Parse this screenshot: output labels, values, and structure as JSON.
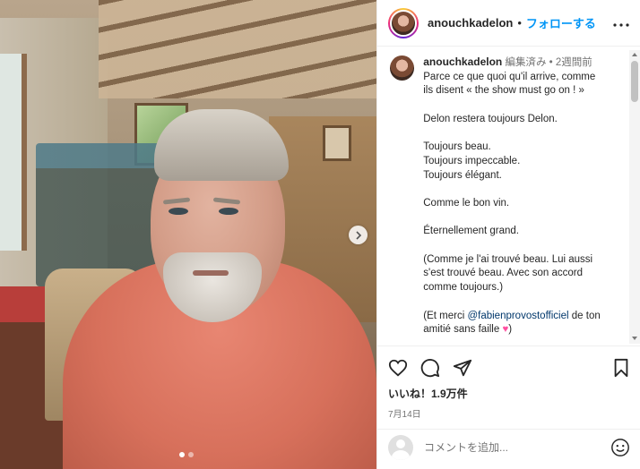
{
  "header": {
    "username": "anouchkadelon",
    "separator": "•",
    "follow_label": "フォローする",
    "more_label": "•••"
  },
  "caption": {
    "username": "anouchkadelon",
    "edited_label": "編集済み",
    "separator": "•",
    "time_ago": "2週間前",
    "lines": [
      "Parce ce que quoi qu'il arrive, comme",
      "ils disent « the show must go on ! »",
      "",
      "Delon restera toujours Delon.",
      "",
      "Toujours beau.",
      "Toujours impeccable.",
      "Toujours élégant.",
      "",
      "Comme le bon vin.",
      "",
      "Éternellement grand.",
      "",
      "(Comme je l'ai trouvé beau. Lui aussi",
      "s'est trouvé beau. Avec son accord",
      "comme toujours.)",
      ""
    ],
    "last_line_prefix": "(Et merci ",
    "mention": "@fabienprovostofficiel",
    "last_line_suffix": " de ton",
    "final_line": "amitié sans faille ",
    "final_emoji": "♥",
    "final_close": ")"
  },
  "actions": {
    "like_icon": "heart-icon",
    "comment_icon": "comment-icon",
    "share_icon": "share-icon",
    "save_icon": "bookmark-icon"
  },
  "likes_label": "いいね！1.9万件",
  "date_label": "7月14日",
  "comment": {
    "placeholder": "コメントを追加...",
    "emoji_icon": "smile-icon"
  },
  "carousel": {
    "next_icon": "chevron-right-icon",
    "slide_count": 2,
    "active_index": 0
  },
  "colors": {
    "accent": "#0095f6",
    "mention": "#00376b",
    "meta": "#737373"
  }
}
